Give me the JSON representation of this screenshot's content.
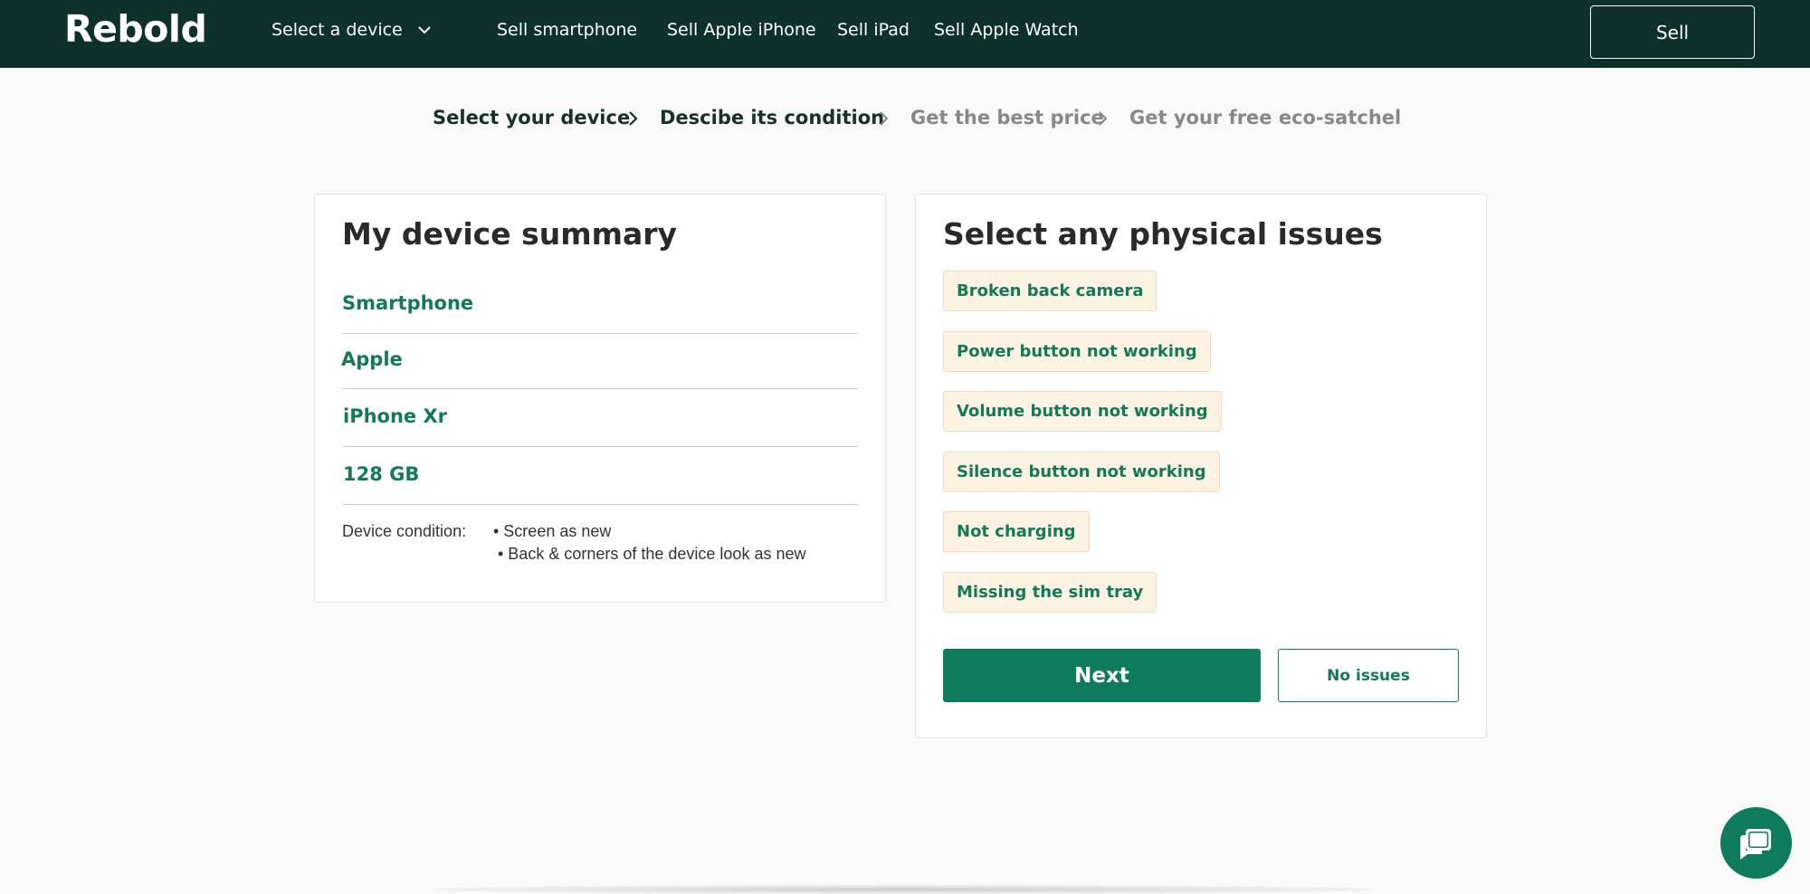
{
  "header": {
    "logo": "Rebold",
    "device_select": "Select a device",
    "nav": [
      "Sell smartphone",
      "Sell Apple iPhone",
      "Sell iPad",
      "Sell Apple Watch"
    ],
    "sell_label": "Sell"
  },
  "steps": [
    {
      "label": "Select your device",
      "state": "active"
    },
    {
      "label": "Descibe its condition",
      "state": "active"
    },
    {
      "label": "Get the best price",
      "state": "inactive"
    },
    {
      "label": "Get your free eco-satchel",
      "state": "inactive"
    }
  ],
  "summary": {
    "title": "My device summary",
    "items": [
      "Smartphone",
      "Apple",
      "iPhone Xr",
      "128 GB"
    ],
    "condition_label": "Device condition:",
    "condition_items": [
      "• Screen as new",
      "• Back & corners of the device look as new"
    ]
  },
  "issues": {
    "title": "Select any physical issues",
    "options": [
      "Broken back camera",
      "Power button not working",
      "Volume button not working",
      "Silence button not working",
      "Not charging",
      "Missing the sim tray"
    ],
    "next_label": "Next",
    "no_issues_label": "No issues"
  },
  "colors": {
    "header_bg": "#0f312c",
    "accent": "#0e7c5c",
    "chip_bg": "#fdf3e3"
  },
  "icons": {
    "dropdown": "chevron-down-icon",
    "step_separator": "chevron-right-icon",
    "chat": "chat-bubble-icon"
  }
}
